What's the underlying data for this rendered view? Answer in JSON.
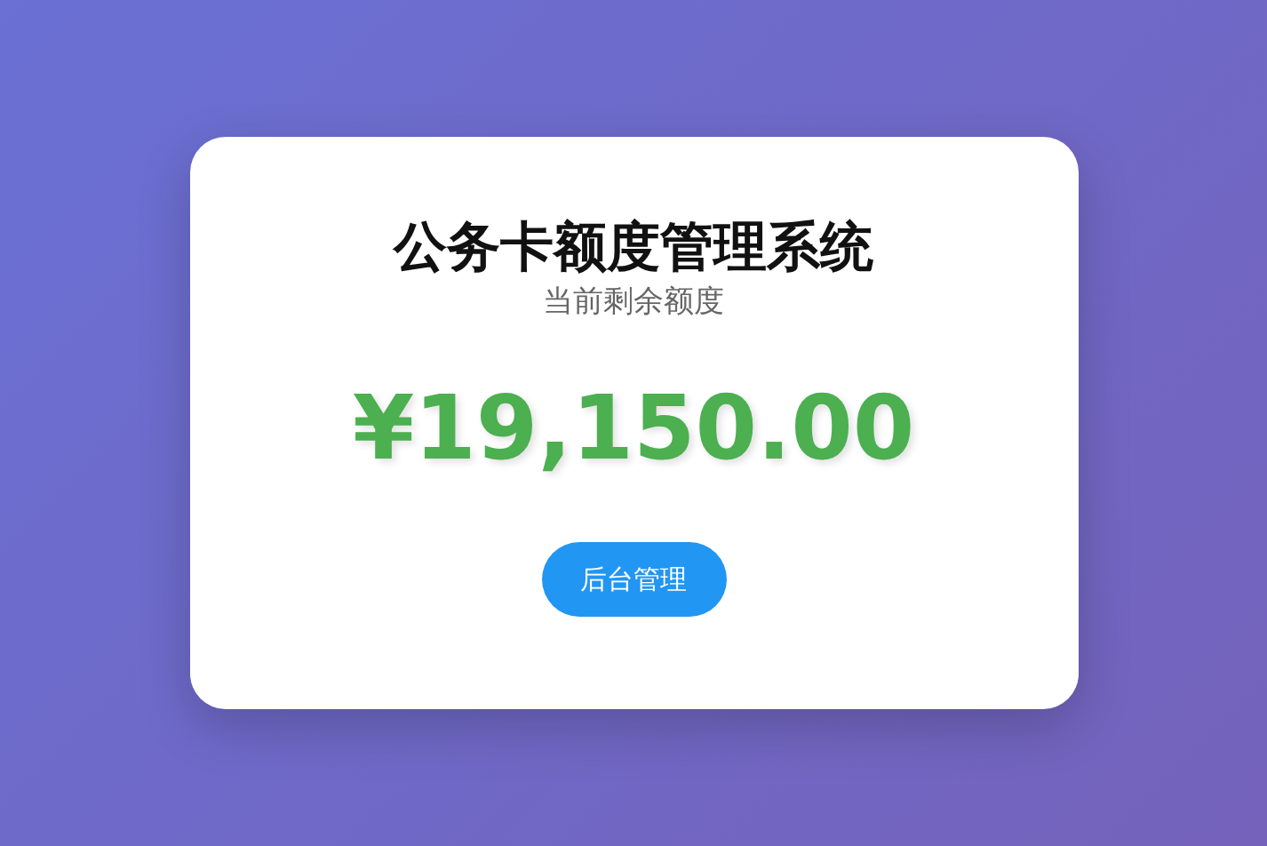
{
  "title": "公务卡额度管理系统",
  "subtitle": "当前剩余额度",
  "amount": "¥19,150.00",
  "button": "后台管理"
}
